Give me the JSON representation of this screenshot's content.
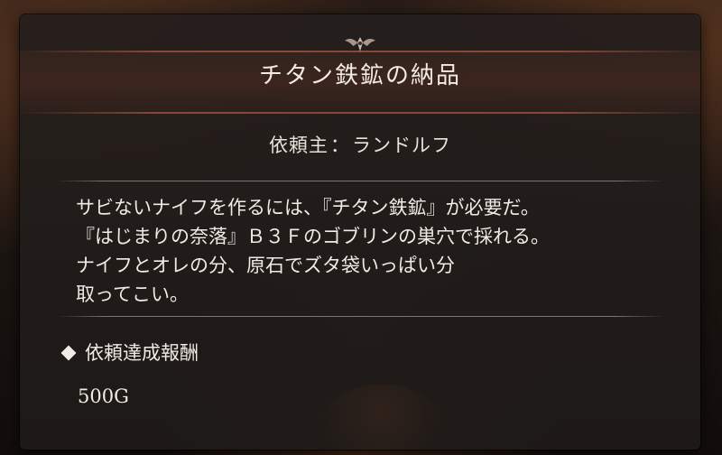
{
  "quest": {
    "title": "チタン鉄鉱の納品",
    "client_label": "依頼主",
    "client_separator": "：",
    "client_name": "ランドルフ",
    "description_lines": [
      "サビないナイフを作るには、『チタン鉄鉱』が必要だ。",
      "『はじまりの奈落』Ｂ３Ｆのゴブリンの巣穴で採れる。",
      "ナイフとオレの分、原石でズタ袋いっぱい分",
      "取ってこい。"
    ],
    "reward": {
      "heading": "依頼達成報酬",
      "value": "500G"
    }
  },
  "icons": {
    "crest": "winged-crest-icon",
    "bullet": "diamond-icon"
  },
  "colors": {
    "text": "#f0ebe4",
    "accent_rule": "#96503c",
    "panel": "#1e1a18"
  }
}
